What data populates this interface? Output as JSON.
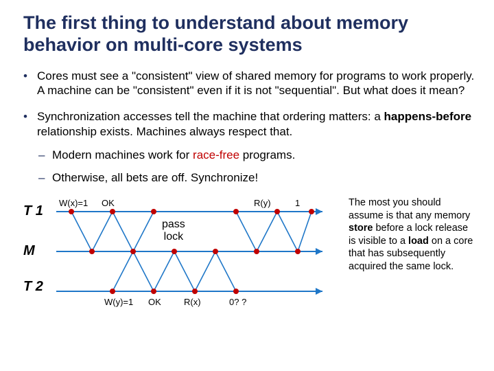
{
  "title": "The first thing to understand about memory behavior on multi-core systems",
  "bullets": {
    "b1": "Cores must see a \"consistent\" view of shared memory for programs to work properly.  A machine can be \"consistent\" even if it is not \"sequential\".  But what does it mean?",
    "b2_pre": "Synchronization accesses tell the machine that ordering matters: a ",
    "b2_bold": "happens-before",
    "b2_post": " relationship exists.  Machines always respect that.",
    "sub1_pre": "Modern machines work for ",
    "sub1_race": "race-free",
    "sub1_post": " programs.",
    "sub2": "Otherwise, all bets are off.  Synchronize!"
  },
  "diagram": {
    "rows": {
      "t1": "T 1",
      "m": "M",
      "t2": "T 2"
    },
    "labels": {
      "wx1": "W(x)=1",
      "ok_top": "OK",
      "ry": "R(y)",
      "one": "1",
      "pass": "pass",
      "lock": "lock",
      "wy1": "W(y)=1",
      "ok_bot": "OK",
      "rx": "R(x)",
      "zeroq": "0? ?"
    }
  },
  "note": {
    "p1": "The most you should assume is that any memory ",
    "b1": "store",
    "p2": " before a lock release is visible to a ",
    "b2": "load",
    "p3": " on a core that has subsequently acquired the same lock."
  }
}
